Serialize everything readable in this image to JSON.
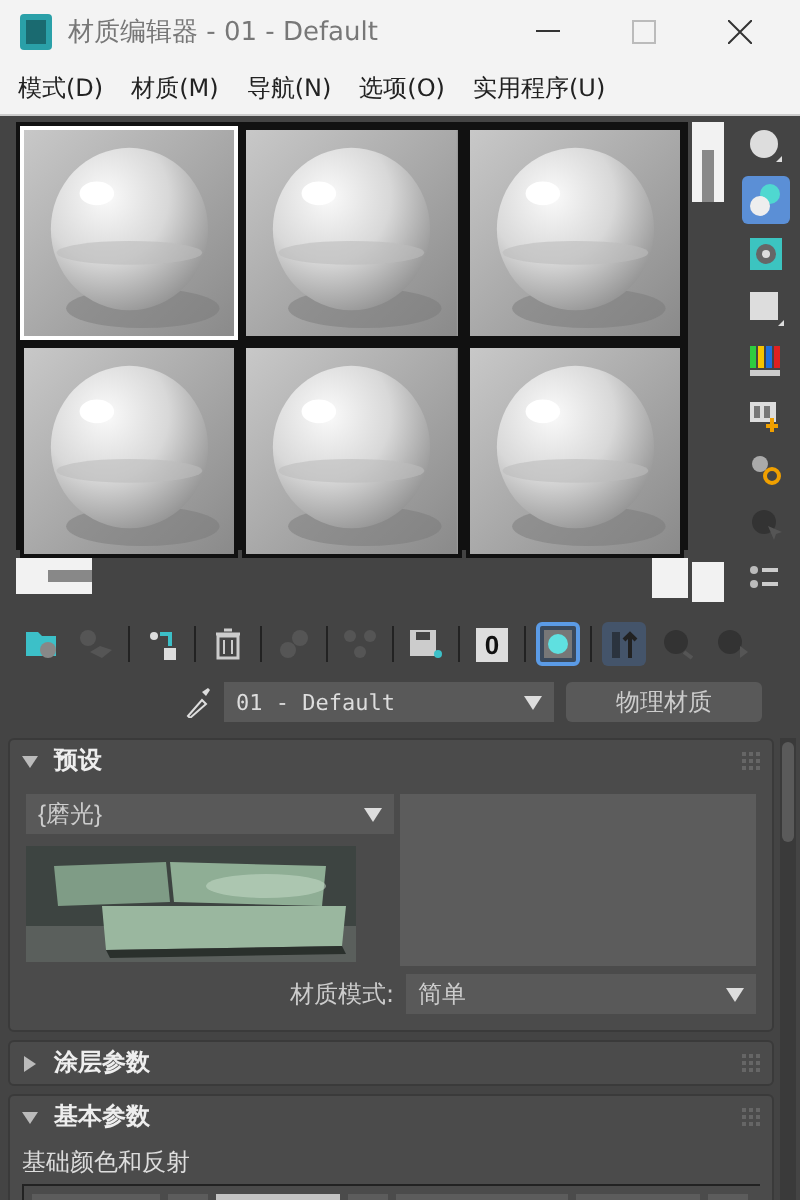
{
  "window": {
    "title": "材质编辑器 - 01 - Default"
  },
  "menu": [
    "模式(D)",
    "材质(M)",
    "导航(N)",
    "选项(O)",
    "实用程序(U)"
  ],
  "sample_slots": [
    {
      "selected": true
    },
    {
      "selected": false
    },
    {
      "selected": false
    },
    {
      "selected": false
    },
    {
      "selected": false
    },
    {
      "selected": false
    }
  ],
  "side_tools": [
    {
      "kind": "sphere",
      "selected": false
    },
    {
      "kind": "backlight",
      "selected": true
    },
    {
      "kind": "checker",
      "selected": false
    },
    {
      "kind": "square",
      "selected": false
    },
    {
      "kind": "colors",
      "selected": false
    },
    {
      "kind": "video",
      "selected": false
    },
    {
      "kind": "options",
      "selected": false
    },
    {
      "kind": "pick",
      "selected": false
    },
    {
      "kind": "list",
      "selected": false
    }
  ],
  "bottom_tools": [
    {
      "kind": "get",
      "selected": false
    },
    {
      "kind": "put",
      "selected": false
    },
    {
      "kind": "assign",
      "selected": false
    },
    {
      "kind": "delete",
      "selected": false
    },
    {
      "kind": "copy",
      "selected": false
    },
    {
      "kind": "unique",
      "selected": false
    },
    {
      "kind": "save",
      "selected": false
    },
    {
      "kind": "id",
      "label": "0",
      "selected": false
    },
    {
      "kind": "show",
      "selected": true
    },
    {
      "kind": "parent",
      "selected": true
    },
    {
      "kind": "sibling",
      "selected": false
    },
    {
      "kind": "next",
      "selected": false
    }
  ],
  "material": {
    "name": "01 - Default",
    "type": "物理材质"
  },
  "rollouts": [
    {
      "kind": "presets",
      "title": "预设",
      "expanded": true
    },
    {
      "title": "涂层参数",
      "expanded": false
    },
    {
      "kind": "basic",
      "title": "基本参数",
      "expanded": true
    }
  ],
  "presets": {
    "value": "{磨光}",
    "mode_label": "材质模式:",
    "mode_value": "简单"
  },
  "basic": {
    "group": "基础颜色和反射"
  }
}
